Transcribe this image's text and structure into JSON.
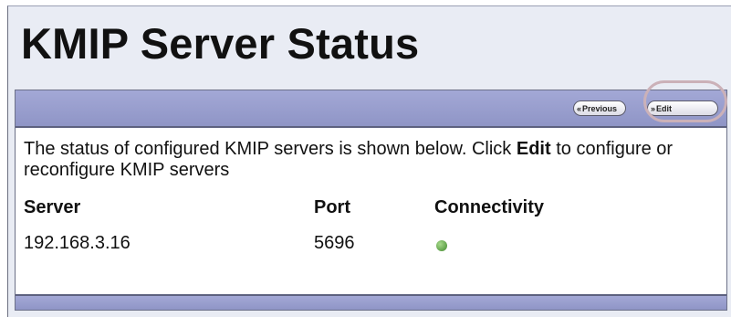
{
  "page": {
    "title": "KMIP Server Status"
  },
  "toolbar": {
    "previous_label": "Previous",
    "edit_label": "Edit",
    "chevron_glyph": "«",
    "edit_chevron_glyph": "»"
  },
  "description": {
    "text_before": "The status of configured KMIP servers is shown below. Click ",
    "bold": "Edit",
    "text_after": " to configure or reconfigure KMIP servers"
  },
  "table": {
    "columns": [
      "Server",
      "Port",
      "Connectivity"
    ],
    "rows": [
      {
        "server": "192.168.3.16",
        "port": "5696",
        "connectivity": "connected",
        "connectivity_icon": "green-status-dot-icon"
      }
    ]
  },
  "colors": {
    "header_bar": "#9a9fce",
    "status_connected": "#6fb556",
    "highlight_ring": "#cbb1b8"
  }
}
